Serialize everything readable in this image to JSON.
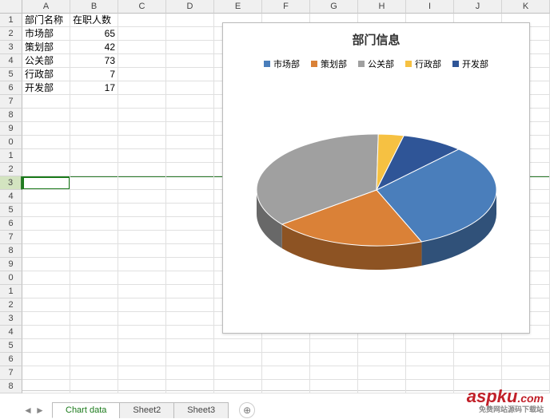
{
  "columns": [
    "A",
    "B",
    "C",
    "D",
    "E",
    "F",
    "G",
    "H",
    "I",
    "J",
    "K"
  ],
  "rows": [
    "1",
    "2",
    "3",
    "4",
    "5",
    "6",
    "7",
    "8",
    "9",
    "0",
    "1",
    "2",
    "3",
    "4",
    "5",
    "6",
    "7",
    "8",
    "9",
    "0",
    "1",
    "2",
    "3",
    "4",
    "5",
    "6",
    "7",
    "8"
  ],
  "selected_row_index": 12,
  "table": {
    "headers": [
      "部门名称",
      "在职人数"
    ],
    "rows": [
      {
        "name": "市场部",
        "count": 65
      },
      {
        "name": "策划部",
        "count": 42
      },
      {
        "name": "公关部",
        "count": 73
      },
      {
        "name": "行政部",
        "count": 7
      },
      {
        "name": "开发部",
        "count": 17
      }
    ]
  },
  "chart_data": {
    "type": "pie",
    "title": "部门信息",
    "categories": [
      "市场部",
      "策划部",
      "公关部",
      "行政部",
      "开发部"
    ],
    "values": [
      65,
      42,
      73,
      7,
      17
    ],
    "colors": [
      "#4a7ebb",
      "#da8137",
      "#a0a0a0",
      "#f6c142",
      "#2f5597"
    ]
  },
  "tabs": {
    "items": [
      "Chart data",
      "Sheet2",
      "Sheet3"
    ],
    "active": 0
  },
  "watermark": {
    "main": "aspku",
    "suffix": ".com",
    "sub": "免费网站源码下载站"
  }
}
